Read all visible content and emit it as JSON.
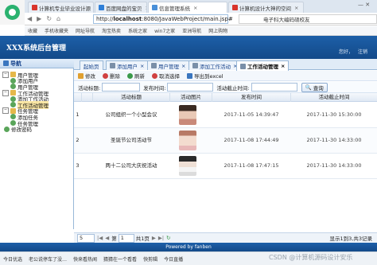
{
  "browser": {
    "tabs": [
      {
        "label": "计算机专业毕业设计源"
      },
      {
        "label": "百度网盘的宝贝"
      },
      {
        "label": "信息管理系统"
      },
      {
        "label": "计算机设计大神的空间"
      }
    ],
    "url_prefix": "http://",
    "url_host": "localhost",
    "url_rest": ":8080/JavaWebProject/main.jsp#",
    "search_text": "电子科大编码硕校友",
    "bookmarks": [
      "收藏",
      "手机收藏夹",
      "网址导航",
      "淘宝热卖",
      "系统之家",
      "win7之家",
      "亚洲导航",
      "网上购物"
    ]
  },
  "app": {
    "title": "XXX系统后台管理",
    "header_right": "您好，",
    "header_right2": "注销",
    "sidebar_title": "导航",
    "tree": [
      {
        "label": "用户管理",
        "level": 0,
        "type": "folder"
      },
      {
        "label": "添加用户",
        "level": 1,
        "type": "leaf"
      },
      {
        "label": "用户管理",
        "level": 1,
        "type": "leaf"
      },
      {
        "label": "工作活动管理",
        "level": 0,
        "type": "folder"
      },
      {
        "label": "添加工作活动",
        "level": 1,
        "type": "leaf"
      },
      {
        "label": "工作活动管理",
        "level": 1,
        "type": "leaf",
        "selected": true
      },
      {
        "label": "任务管理",
        "level": 0,
        "type": "folder"
      },
      {
        "label": "添加任务",
        "level": 1,
        "type": "leaf"
      },
      {
        "label": "任务管理",
        "level": 1,
        "type": "leaf"
      },
      {
        "label": "修改密码",
        "level": 0,
        "type": "leaf"
      }
    ],
    "content_tabs": [
      "起始页",
      "添加用户",
      "用户管理",
      "添加工作活动",
      "工作活动管理"
    ],
    "toolbar": [
      "修改",
      "删除",
      "刷新",
      "取消选择",
      "导出到excel"
    ],
    "search": {
      "title_label": "活动标题:",
      "pub_label": "发布时间:",
      "deadline_label": "活动截止时间:",
      "button": "查询"
    },
    "grid": {
      "headers": [
        "活动标题",
        "活动图片",
        "发布时间",
        "活动截止时间"
      ],
      "rows": [
        {
          "no": "1",
          "title": "公司组织一个小型会议",
          "pub": "2017-11-05 14:39:47",
          "deadline": "2017-11-30 15:30:00"
        },
        {
          "no": "2",
          "title": "圣诞节公司活动节",
          "pub": "2017-11-08 17:44:49",
          "deadline": "2017-11-30 14:33:00"
        },
        {
          "no": "3",
          "title": "两十二公司大庆祝活动",
          "pub": "2017-11-08 17:47:15",
          "deadline": "2017-11-30 14:33:00"
        }
      ]
    },
    "pager": {
      "page_size": "5",
      "page_label_pre": "第",
      "page_value": "1",
      "page_label_post": "共1页",
      "info": "显示1到3,共3记录"
    },
    "footer": "Powered by fanben"
  },
  "statusbar": {
    "items": [
      "今日优选",
      "老公说停车了没…",
      "快来看热闻",
      "猜猜在一个看看",
      "快剪辑",
      "今日直播",
      "热点资讯"
    ],
    "watermark": "CSDN @计算机源码设计安乐"
  }
}
